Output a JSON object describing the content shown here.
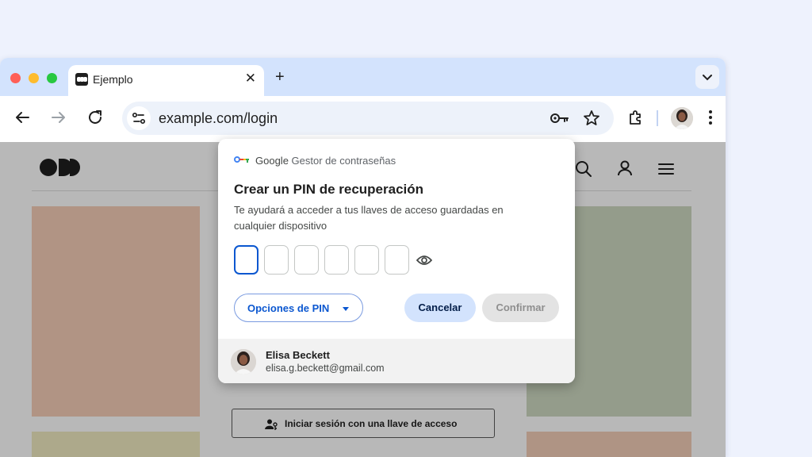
{
  "colors": {
    "background": "#eef2fd",
    "tabstrip": "#d3e3fd",
    "accent": "#0b57d0",
    "primary_tonal_button": "#d3e3fd",
    "disabled_button": "#e3e3e3"
  },
  "browser": {
    "tab": {
      "title": "Ejemplo",
      "favicon": "odd-logo-icon",
      "close_label": "✕"
    },
    "new_tab_label": "+",
    "address_bar": {
      "url": "example.com/login"
    },
    "toolbar_icons": [
      "back-arrow-icon",
      "forward-arrow-icon",
      "reload-icon",
      "site-info-icon",
      "key-icon",
      "star-icon",
      "extensions-icon",
      "avatar",
      "more-vert-icon"
    ]
  },
  "website": {
    "header_icons": [
      "search-icon",
      "person-icon",
      "menu-icon"
    ],
    "passkey_button": "Iniciar sesión con una llave de acceso"
  },
  "password_manager_dialog": {
    "google_label": "Google",
    "product_label": "Gestor de contraseñas",
    "title": "Crear un PIN de recuperación",
    "description": "Te ayudará a acceder a tus llaves de acceso guardadas en cualquier dispositivo",
    "pin_digits": [
      "",
      "",
      "",
      "",
      "",
      ""
    ],
    "show_pin_icon": "eye-icon",
    "buttons": {
      "pin_options": "Opciones de PIN",
      "cancel": "Cancelar",
      "confirm": "Confirmar"
    },
    "account": {
      "name": "Elisa Beckett",
      "email": "elisa.g.beckett@gmail.com"
    }
  }
}
